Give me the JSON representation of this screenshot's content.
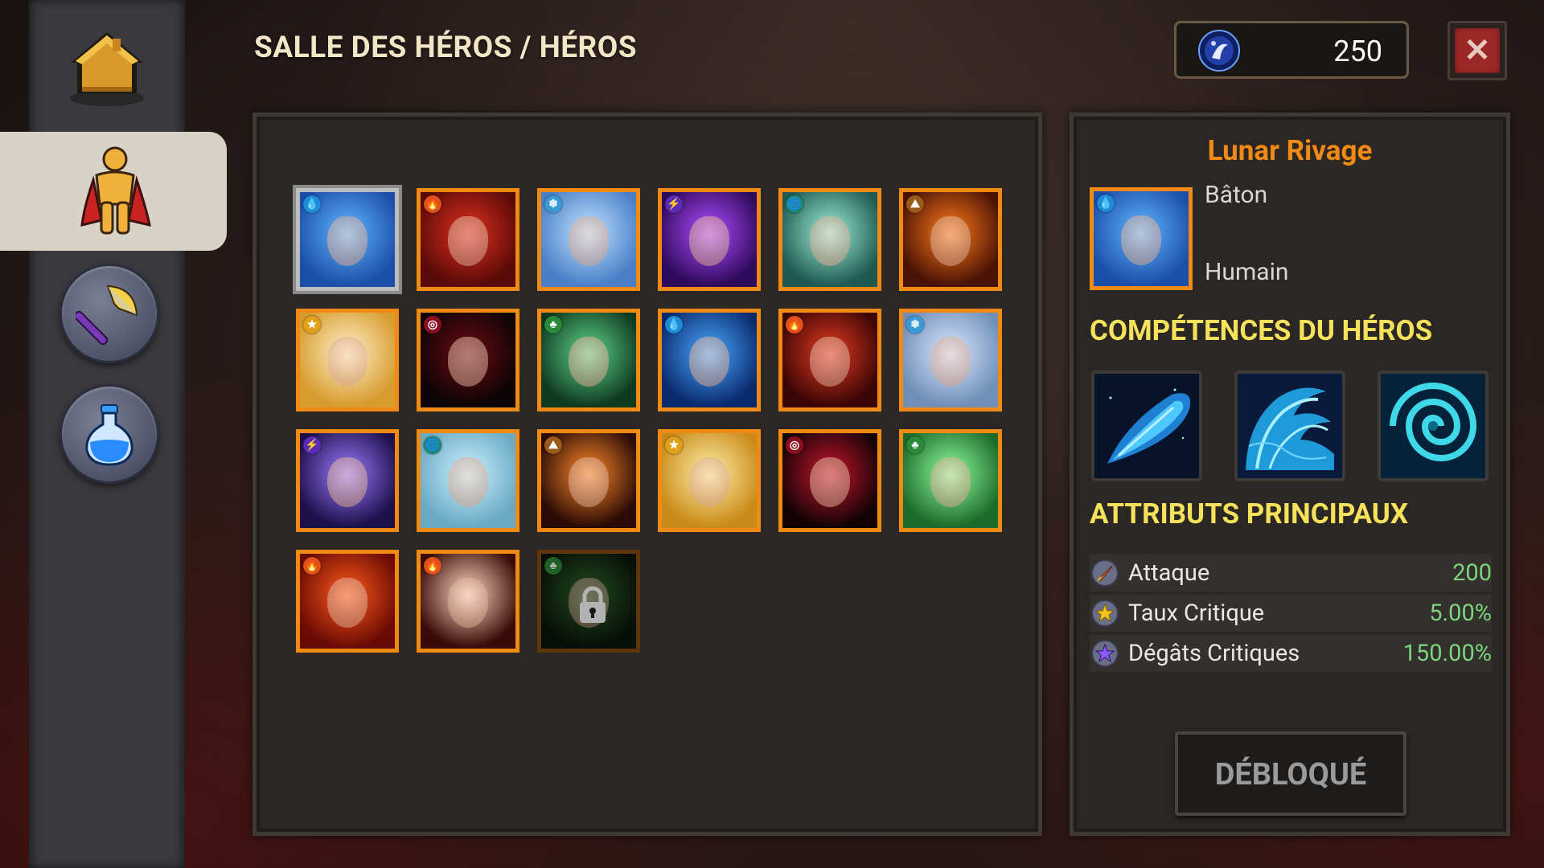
{
  "header": {
    "title": "SALLE DES HÉROS / HÉROS",
    "currency_value": "250",
    "close_label": "✕"
  },
  "sidebar": {
    "items": [
      {
        "name": "home",
        "icon": "house-icon"
      },
      {
        "name": "heroes",
        "icon": "hero-cape-icon",
        "active": true
      },
      {
        "name": "weapons",
        "icon": "axe-icon"
      },
      {
        "name": "potions",
        "icon": "potion-flask-icon"
      }
    ]
  },
  "heroes": [
    {
      "element": "water",
      "palette": [
        "#5fb6ff",
        "#1b4fa8"
      ],
      "selected": true
    },
    {
      "element": "fire",
      "palette": [
        "#e0301e",
        "#5a0a08"
      ]
    },
    {
      "element": "ice",
      "palette": [
        "#bfe3ff",
        "#4a7fc8"
      ]
    },
    {
      "element": "lightning",
      "palette": [
        "#b24cff",
        "#2e0a5c"
      ]
    },
    {
      "element": "wind",
      "palette": [
        "#9ff0d6",
        "#1f5a52"
      ]
    },
    {
      "element": "earth",
      "palette": [
        "#ff7a1a",
        "#4a1204"
      ]
    },
    {
      "element": "light",
      "palette": [
        "#fff1c8",
        "#d79b2e"
      ]
    },
    {
      "element": "dark",
      "palette": [
        "#6b0b12",
        "#0c0406"
      ]
    },
    {
      "element": "nature",
      "palette": [
        "#5fd58a",
        "#0f3a20"
      ]
    },
    {
      "element": "water",
      "palette": [
        "#4aa9ff",
        "#0a2a6e"
      ]
    },
    {
      "element": "fire",
      "palette": [
        "#e63a1f",
        "#3a0505"
      ]
    },
    {
      "element": "ice",
      "palette": [
        "#dbe8ff",
        "#6f8fb8"
      ]
    },
    {
      "element": "lightning",
      "palette": [
        "#9b7bff",
        "#1c0f4a"
      ]
    },
    {
      "element": "wind",
      "palette": [
        "#cbf1ff",
        "#6aa9c4"
      ]
    },
    {
      "element": "earth",
      "palette": [
        "#ff8a2a",
        "#2a0a04"
      ]
    },
    {
      "element": "light",
      "palette": [
        "#fff0a8",
        "#c98a18"
      ]
    },
    {
      "element": "dark",
      "palette": [
        "#c8142a",
        "#120306"
      ]
    },
    {
      "element": "nature",
      "palette": [
        "#8cff9c",
        "#1d6a2a"
      ]
    },
    {
      "element": "fire",
      "palette": [
        "#ff5a1a",
        "#6a0a04"
      ]
    },
    {
      "element": "fire",
      "palette": [
        "#ffd9c2",
        "#3a0a06"
      ]
    },
    {
      "element": "nature",
      "palette": [
        "#2e6a2a",
        "#0a140a"
      ],
      "locked": true
    }
  ],
  "selected_hero": {
    "name": "Lunar Rivage",
    "weapon": "Bâton",
    "race": "Humain"
  },
  "sections": {
    "skills": "COMPÉTENCES DU HÉROS",
    "attributes": "ATTRIBUTS PRINCIPAUX"
  },
  "skills": [
    {
      "icon": "water-comet-skill-icon"
    },
    {
      "icon": "water-wave-skill-icon"
    },
    {
      "icon": "water-vortex-skill-icon"
    }
  ],
  "attributes": [
    {
      "label": "Attaque",
      "value": "200",
      "icon": "sword-icon"
    },
    {
      "label": "Taux Critique",
      "value": "5.00%",
      "icon": "star-icon"
    },
    {
      "label": "Dégâts Critiques",
      "value": "150.00%",
      "icon": "purple-star-icon"
    }
  ],
  "unlock_button": "DÉBLOQUÉ",
  "colors": {
    "accent_orange": "#f08a14",
    "section_yellow": "#f5e15a",
    "value_green": "#7cd67c"
  }
}
